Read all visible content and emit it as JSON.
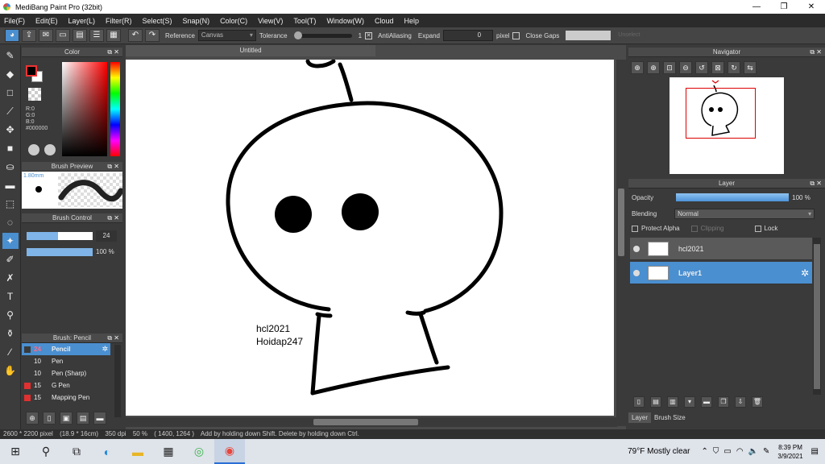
{
  "window": {
    "title": "MediBang Paint Pro (32bit)"
  },
  "menu": [
    "File(F)",
    "Edit(E)",
    "Layer(L)",
    "Filter(R)",
    "Select(S)",
    "Snap(N)",
    "Color(C)",
    "View(V)",
    "Tool(T)",
    "Window(W)",
    "Cloud",
    "Help"
  ],
  "toolbar": {
    "reference_label": "Reference",
    "reference_value": "Canvas",
    "tolerance_label": "Tolerance",
    "tolerance_value": "1",
    "antialiasing_label": "AntiAliasing",
    "expand_label": "Expand",
    "expand_value": "0",
    "expand_unit": "pixel",
    "close_gaps_label": "Close Gaps",
    "unselect_label": "Unselect"
  },
  "color_panel": {
    "title": "Color",
    "r": "R:0",
    "g": "G:0",
    "b": "B:0",
    "hex": "#000000",
    "fg_color": "#000000",
    "bg_color": "#ffffff"
  },
  "brush_preview": {
    "title": "Brush Preview",
    "size": "1.80mm"
  },
  "brush_control": {
    "title": "Brush Control",
    "size_value": "24",
    "opacity_value": "100 %",
    "size_fill": 0.48,
    "opacity_fill": 1.0
  },
  "brush_list": {
    "title": "Brush: Pencil",
    "items": [
      {
        "size": "24",
        "name": "Pencil",
        "color": "#3a3a3a",
        "selected": true
      },
      {
        "size": "10",
        "name": "Pen",
        "color": "#3a3a3a"
      },
      {
        "size": "10",
        "name": "Pen (Sharp)",
        "color": "#3a3a3a"
      },
      {
        "size": "15",
        "name": "G Pen",
        "color": "#e03030"
      },
      {
        "size": "15",
        "name": "Mapping Pen",
        "color": "#e03030"
      }
    ]
  },
  "canvas": {
    "tab_title": "Untitled",
    "text_line1": "hcl2021",
    "text_line2": "Hoidap247"
  },
  "navigator": {
    "title": "Navigator"
  },
  "layer_panel": {
    "title": "Layer",
    "opacity_label": "Opacity",
    "opacity_value": "100 %",
    "blending_label": "Blending",
    "blending_value": "Normal",
    "protect_alpha_label": "Protect Alpha",
    "clipping_label": "Clipping",
    "lock_label": "Lock",
    "layers": [
      {
        "name": "hcl2021",
        "selected": false
      },
      {
        "name": "Layer1",
        "selected": true
      }
    ],
    "tab_layer": "Layer",
    "tab_brush_size": "Brush Size"
  },
  "status": {
    "size": "2600 * 2200 pixel",
    "physical": "(18.9 * 16cm)",
    "dpi": "350 dpi",
    "zoom": "50 %",
    "coords": "( 1400, 1264 )",
    "hint": "Add by holding down Shift. Delete by holding down Ctrl."
  },
  "taskbar": {
    "weather": "79°F  Mostly clear",
    "time": "8:39 PM",
    "date": "3/9/2021"
  }
}
